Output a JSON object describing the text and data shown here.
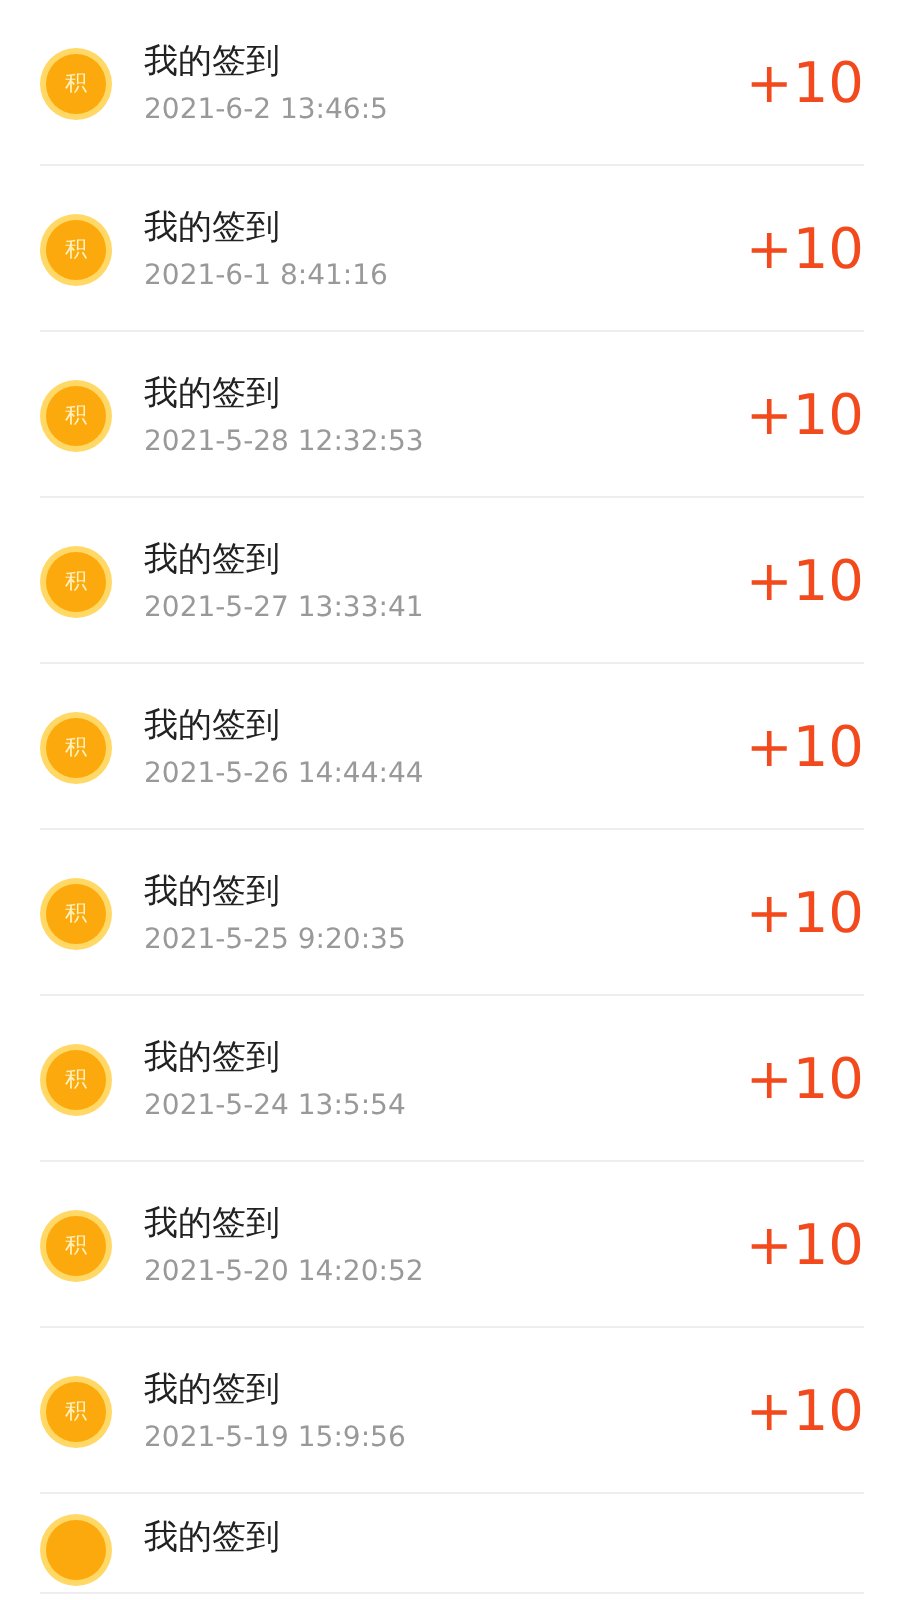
{
  "records": [
    {
      "coin": "积",
      "title": "我的签到",
      "time": "2021-6-2 13:46:5",
      "points": "+10"
    },
    {
      "coin": "积",
      "title": "我的签到",
      "time": "2021-6-1 8:41:16",
      "points": "+10"
    },
    {
      "coin": "积",
      "title": "我的签到",
      "time": "2021-5-28 12:32:53",
      "points": "+10"
    },
    {
      "coin": "积",
      "title": "我的签到",
      "time": "2021-5-27 13:33:41",
      "points": "+10"
    },
    {
      "coin": "积",
      "title": "我的签到",
      "time": "2021-5-26 14:44:44",
      "points": "+10"
    },
    {
      "coin": "积",
      "title": "我的签到",
      "time": "2021-5-25 9:20:35",
      "points": "+10"
    },
    {
      "coin": "积",
      "title": "我的签到",
      "time": "2021-5-24 13:5:54",
      "points": "+10"
    },
    {
      "coin": "积",
      "title": "我的签到",
      "time": "2021-5-20 14:20:52",
      "points": "+10"
    },
    {
      "coin": "积",
      "title": "我的签到",
      "time": "2021-5-19 15:9:56",
      "points": "+10"
    },
    {
      "title": "我的签到"
    }
  ]
}
